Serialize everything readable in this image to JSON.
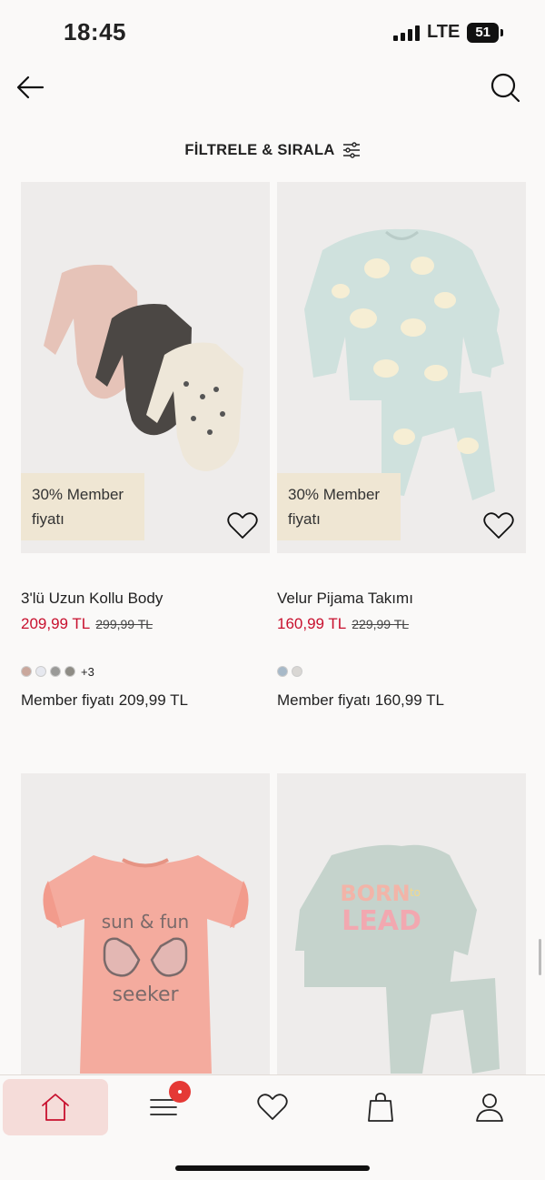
{
  "status": {
    "time": "18:45",
    "network": "LTE",
    "battery": "51"
  },
  "nav": {
    "back_icon": "arrow-left-icon",
    "search_icon": "search-icon"
  },
  "filter": {
    "label": "FİLTRELE & SIRALA",
    "icon": "sliders-icon"
  },
  "products": [
    {
      "name": "3'lü Uzun Kollu Body",
      "badge": "30% Member fiyatı",
      "price": "209,99 TL",
      "old_price": "299,99 TL",
      "swatches": [
        "#c9a79c",
        "#e6e8ef",
        "#9a9a98",
        "#8e8c85"
      ],
      "more_colors": "+3",
      "member_price": "Member fiyatı 209,99 TL"
    },
    {
      "name": "Velur Pijama Takımı",
      "badge": "30% Member fiyatı",
      "price": "160,99 TL",
      "old_price": "229,99 TL",
      "swatches": [
        "#a7b9c8",
        "#d9d7d4"
      ],
      "more_colors": "",
      "member_price": "Member fiyatı 160,99 TL"
    },
    {
      "name": "",
      "graphic_text": [
        "sun & fun",
        "seeker"
      ]
    },
    {
      "name": "",
      "graphic_text": [
        "BORN",
        "to",
        "LEAD"
      ]
    }
  ],
  "tabbar": {
    "items": [
      {
        "icon": "home-icon",
        "active": true
      },
      {
        "icon": "menu-icon",
        "active": false
      },
      {
        "icon": "heart-icon",
        "active": false
      },
      {
        "icon": "shopping-bag-icon",
        "active": false
      },
      {
        "icon": "user-icon",
        "active": false
      }
    ]
  },
  "colors": {
    "accent_red": "#c8102e",
    "badge_bg": "#efe6d3",
    "active_tab_bg": "#f5dcd9",
    "notification": "#e53935"
  }
}
